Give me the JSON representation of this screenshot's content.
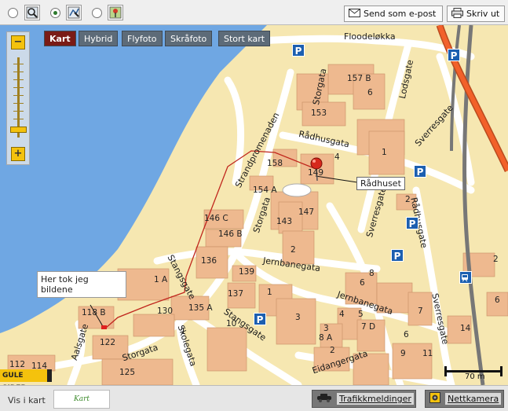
{
  "toolbar": {
    "send_email_label": "Send som e-post",
    "print_label": "Skriv ut"
  },
  "map_types": {
    "kart": "Kart",
    "hybrid": "Hybrid",
    "flyfoto": "Flyfoto",
    "skrafoto": "Skråfoto",
    "stort_kart": "Stort kart"
  },
  "zoom": {
    "minus": "−",
    "plus": "+",
    "level": 0.9
  },
  "streets": {
    "floodelokka": "Floodeløkka",
    "lodsgate": "Lodsgate",
    "storgata_n": "Storgata",
    "radhusgata": "Rådhusgata",
    "sverresgate_ne": "Sverresgate",
    "strandpromenaden": "Strandpromenaden",
    "storgata_mid": "Storgata",
    "sverresgate_mid": "Sverresgate",
    "radhusgate_e": "Rådhusgate",
    "stangsgate_w": "Stangsgate",
    "jernbanegata_n": "Jernbanegata",
    "jernbanegata_s": "Jernbanegata",
    "stangsgate_s": "Stangsgate",
    "skolegata": "Skolegata",
    "storgata_s": "Storgata",
    "aalsgate": "Aalsgate",
    "eidangergata": "Eidangergata",
    "sverresgate_s": "Sverresgate"
  },
  "house_numbers": [
    "157 B",
    "6",
    "153",
    "158",
    "4",
    "1",
    "149",
    "154 A",
    "2",
    "147",
    "143",
    "146 C",
    "146 B",
    "136",
    "2",
    "1 A",
    "139",
    "137",
    "1",
    "8",
    "6",
    "135 A",
    "130",
    "118 B",
    "3",
    "7",
    "4",
    "5",
    "10",
    "1",
    "3",
    "122",
    "7 D",
    "14",
    "6",
    "8 A",
    "9",
    "11",
    "112",
    "114",
    "125",
    "2",
    "6",
    "2"
  ],
  "pin_label": "Rådhuset",
  "callout_text": "Her tok jeg bildene",
  "scale_label": "70 m",
  "provider_logo": "GULE SIDER",
  "bottom": {
    "vis_i_kart": "Vis i kart",
    "logo_text": "Kart",
    "traffic_label": "Trafikkmeldinger",
    "webcam_label": "Nettkamera"
  },
  "colors": {
    "water": "#6fa7e3",
    "land": "#f6e7b1",
    "building": "#eeb98f",
    "road": "#ffffff",
    "railway": "#777777",
    "highway": "#f2612a",
    "parking": "#1c5fb0",
    "active_tab": "#7a1b16"
  }
}
